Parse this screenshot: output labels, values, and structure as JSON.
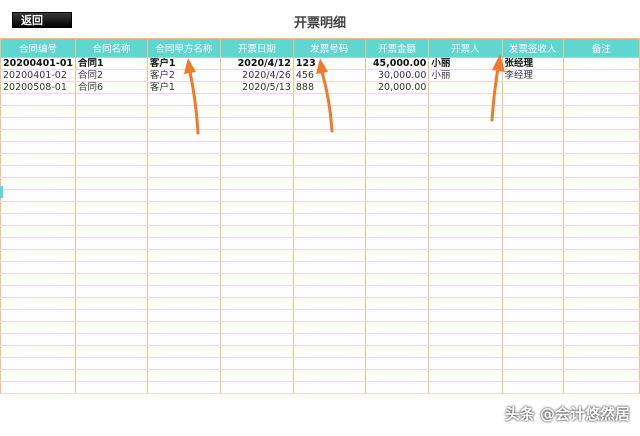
{
  "toolbar": {
    "back_label": "返回"
  },
  "page": {
    "title": "开票明细"
  },
  "table": {
    "headers": [
      "合同编号",
      "合同名称",
      "合同甲方名称",
      "开票日期",
      "发票号码",
      "开票金额",
      "开票人",
      "发票签收人",
      "备注"
    ],
    "rows": [
      [
        "20200401-01",
        "合同1",
        "客户1",
        "2020/4/12",
        "123",
        "45,000.00",
        "小丽",
        "张经理",
        ""
      ],
      [
        "20200401-02",
        "合同2",
        "客户2",
        "2020/4/26",
        "456",
        "30,000.00",
        "小丽",
        "李经理",
        ""
      ],
      [
        "20200508-01",
        "合同6",
        "客户1",
        "2020/5/13",
        "888",
        "20,000.00",
        "",
        "",
        ""
      ]
    ]
  },
  "colors": {
    "header_bg": "#5fd6cf",
    "grid_line": "#f2c08a",
    "arrow": "#f07a2a"
  },
  "watermark": "头条 @会计悠然居"
}
